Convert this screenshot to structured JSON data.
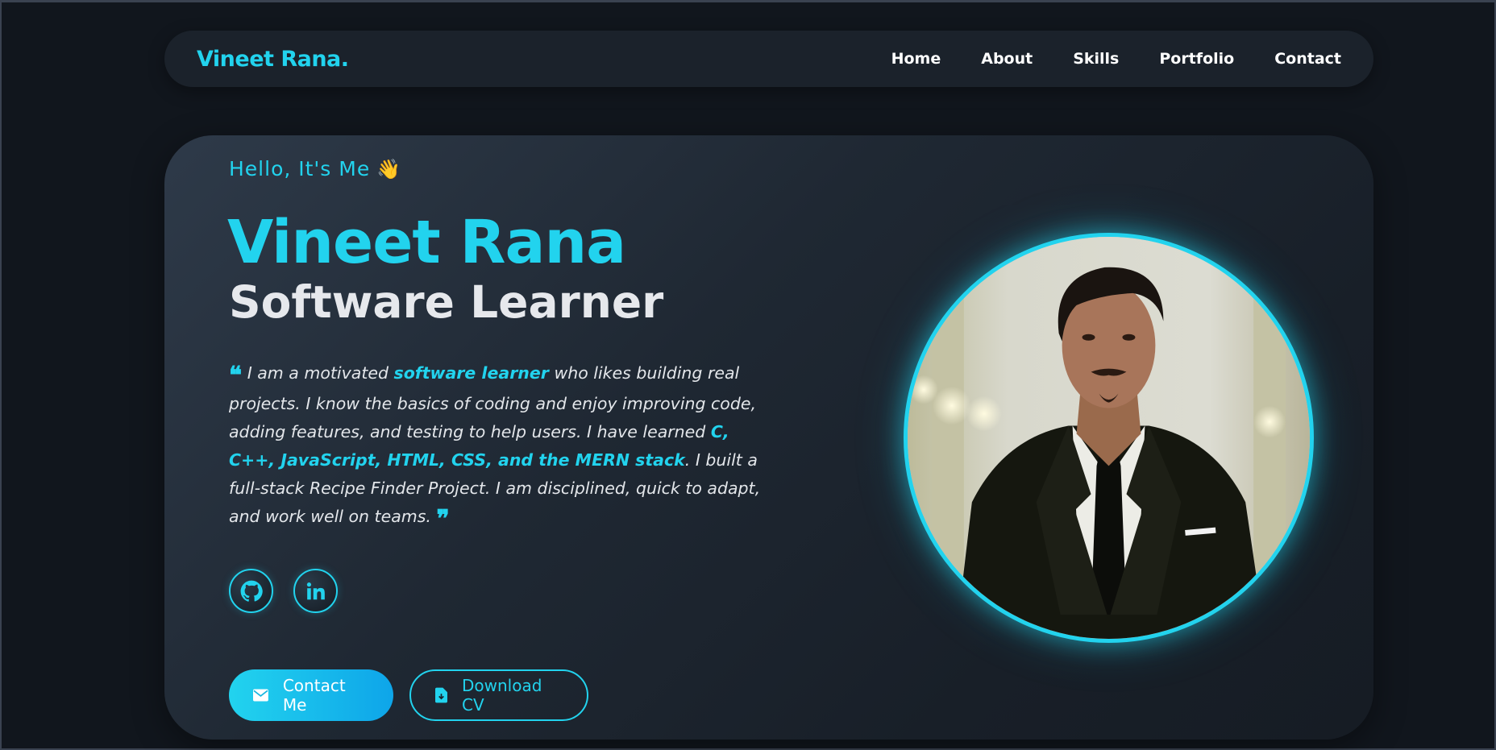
{
  "brand": {
    "logo": "Vineet Rana."
  },
  "nav": {
    "items": [
      "Home",
      "About",
      "Skills",
      "Portfolio",
      "Contact"
    ]
  },
  "hero": {
    "greeting": "Hello, It's Me",
    "greeting_emoji": "👋",
    "name": "Vineet Rana",
    "role": "Software Learner",
    "bio": {
      "p1": "I am a motivated ",
      "h1": "software learner",
      "p2": " who likes building real projects. I know the basics of coding and enjoy improving code, adding features, and testing to help users. I have learned ",
      "h2": "C, C++, JavaScript, HTML, CSS, and the MERN stack",
      "p3": ". I built a full-stack Recipe Finder Project. I am disciplined, quick to adapt, and work well on teams."
    },
    "socials": [
      "github-icon",
      "linkedin-icon"
    ],
    "buttons": {
      "contact": "Contact Me",
      "download": "Download CV"
    }
  },
  "colors": {
    "accent": "#22d3ee",
    "background": "#11161d",
    "card": "#1b222b"
  }
}
